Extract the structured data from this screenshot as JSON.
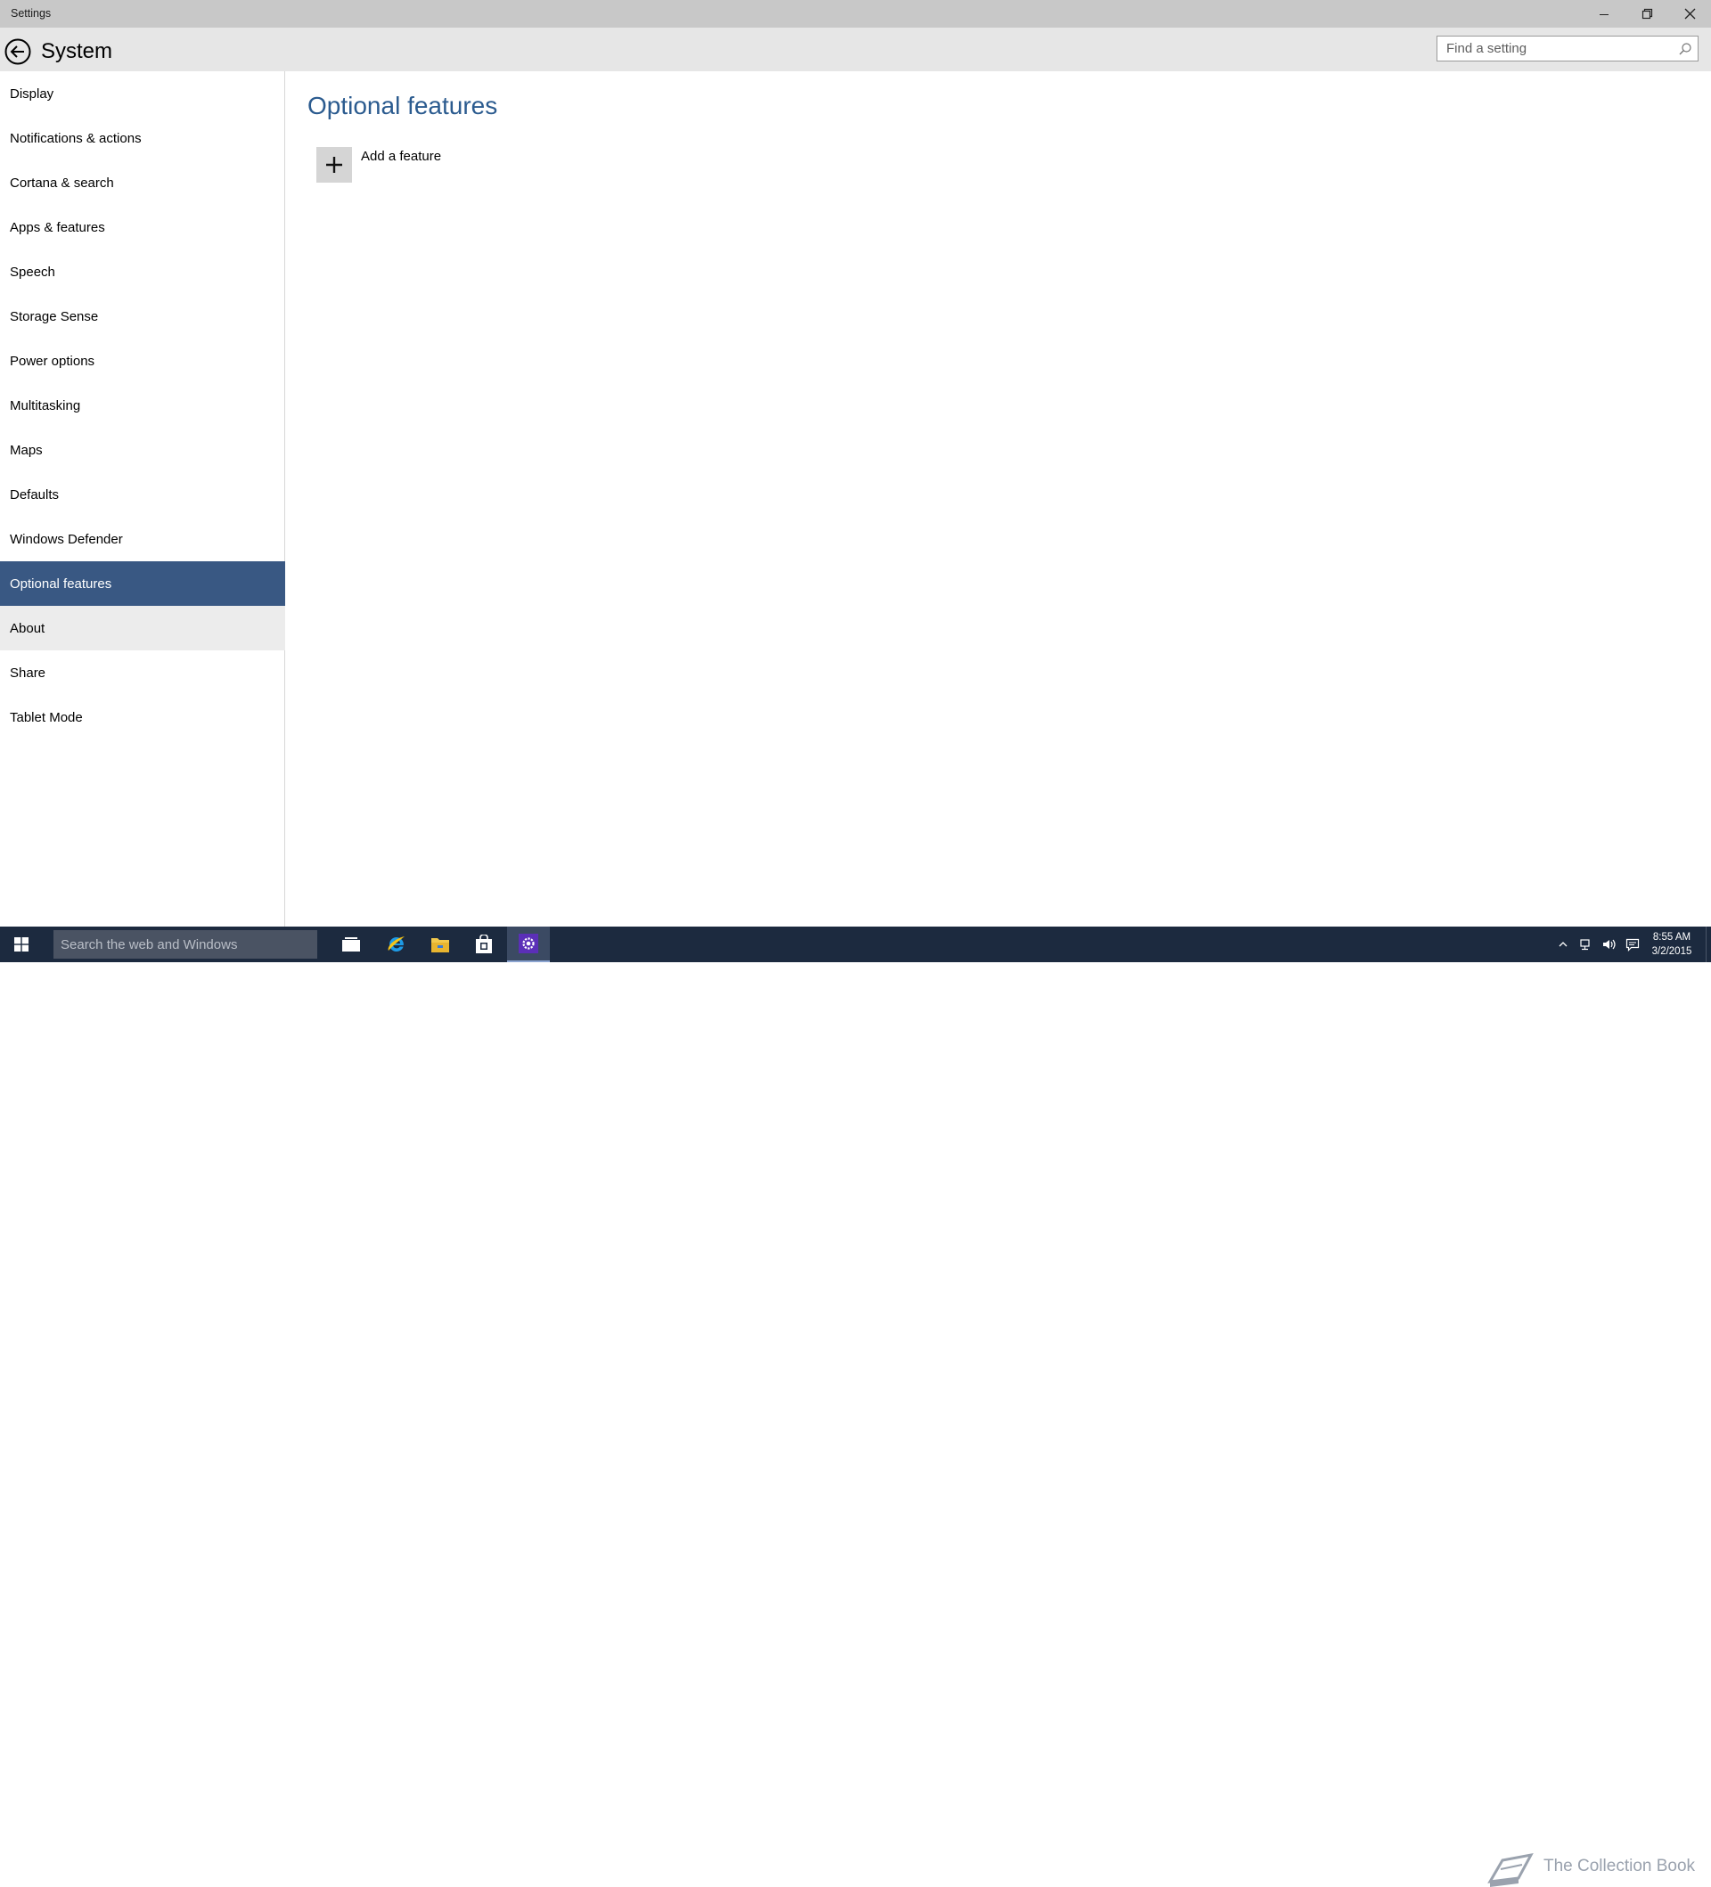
{
  "window": {
    "title": "Settings"
  },
  "header": {
    "title": "System",
    "search_placeholder": "Find a setting"
  },
  "sidebar": {
    "items": [
      {
        "label": "Display",
        "state": "normal"
      },
      {
        "label": "Notifications & actions",
        "state": "normal"
      },
      {
        "label": "Cortana & search",
        "state": "normal"
      },
      {
        "label": "Apps & features",
        "state": "normal"
      },
      {
        "label": "Speech",
        "state": "normal"
      },
      {
        "label": "Storage Sense",
        "state": "normal"
      },
      {
        "label": "Power options",
        "state": "normal"
      },
      {
        "label": "Multitasking",
        "state": "normal"
      },
      {
        "label": "Maps",
        "state": "normal"
      },
      {
        "label": "Defaults",
        "state": "normal"
      },
      {
        "label": "Windows Defender",
        "state": "normal"
      },
      {
        "label": "Optional features",
        "state": "selected"
      },
      {
        "label": "About",
        "state": "hover"
      },
      {
        "label": "Share",
        "state": "normal"
      },
      {
        "label": "Tablet Mode",
        "state": "normal"
      }
    ]
  },
  "main": {
    "title": "Optional features",
    "add_feature_label": "Add a feature"
  },
  "taskbar": {
    "search_placeholder": "Search the web and Windows",
    "apps": [
      "task-view-icon",
      "internet-explorer-icon",
      "file-explorer-icon",
      "store-icon",
      "settings-icon"
    ],
    "watermark": "The Collection Book",
    "time": "8:55 AM",
    "date": "3/2/2015"
  },
  "colors": {
    "accent": "#395883",
    "title_text": "#2b5b8f",
    "taskbar": "#1c2a3f",
    "titlebar": "#c8c8c8",
    "header": "#e6e6e6"
  }
}
